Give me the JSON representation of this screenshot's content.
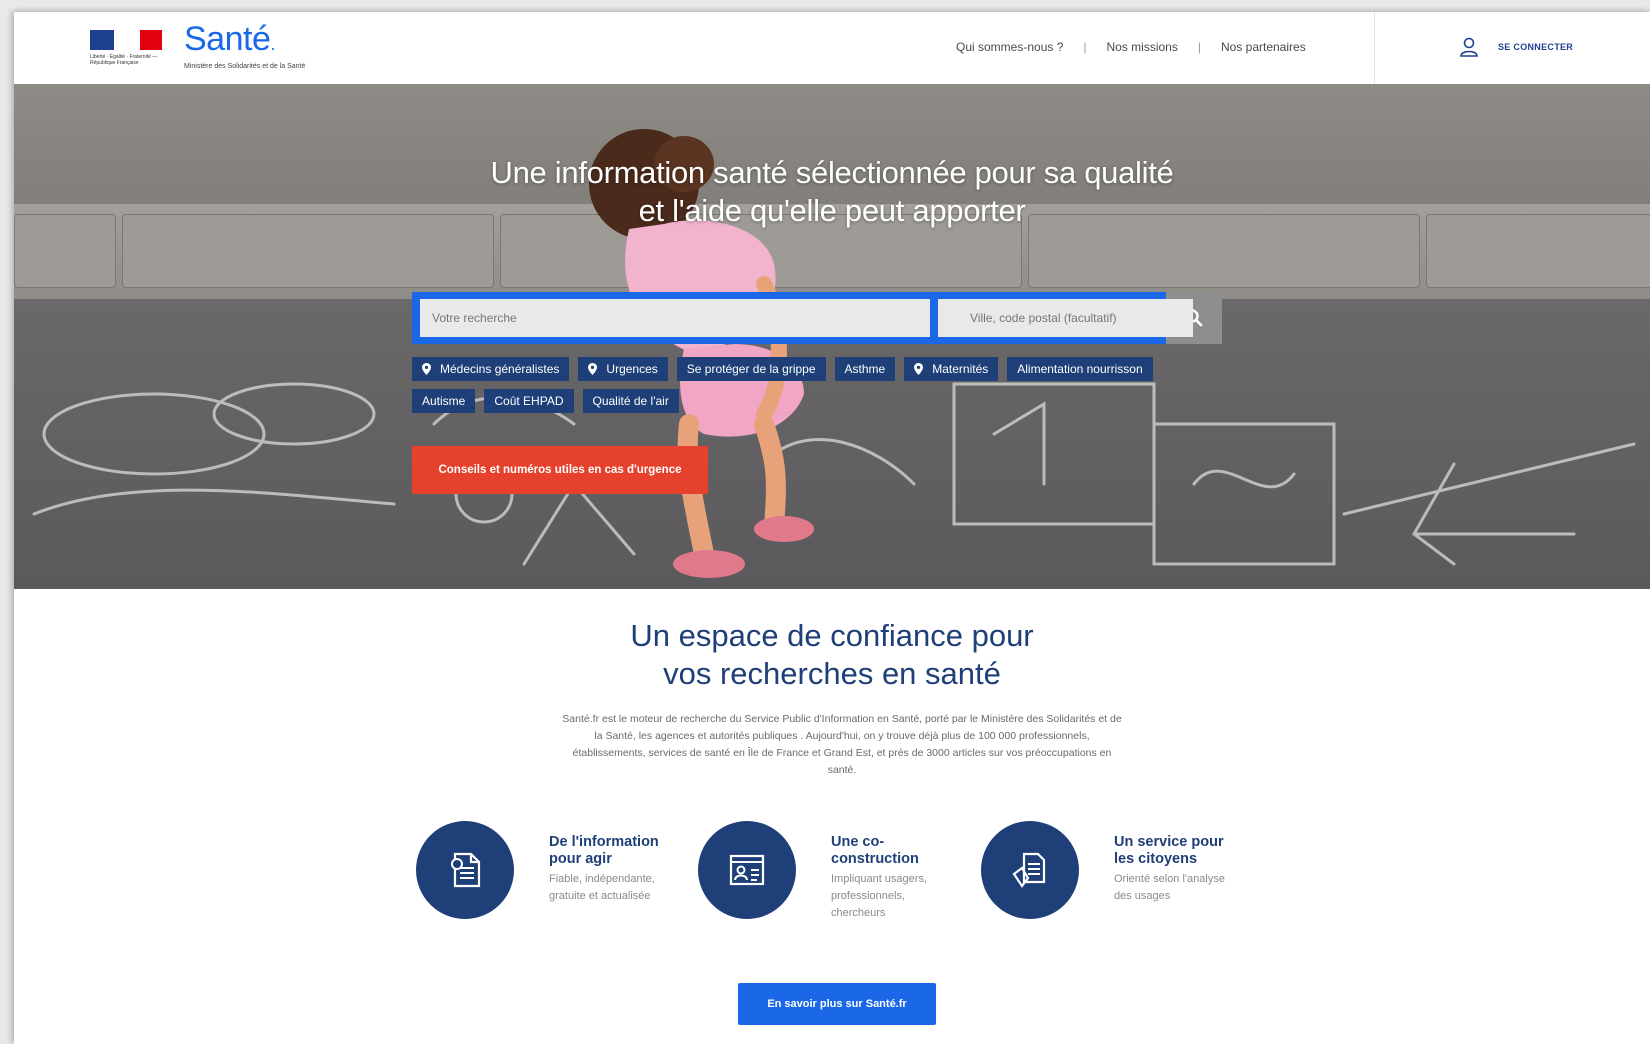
{
  "header": {
    "marianne_text": "Liberté · Égalité · Fraternité — République Française",
    "brand_name": "Santé",
    "brand_dot": ".",
    "brand_subtitle": "Ministère des Solidarités et de la Santé",
    "nav": [
      {
        "label": "Qui sommes-nous ?"
      },
      {
        "label": "Nos missions"
      },
      {
        "label": "Nos partenaires"
      }
    ],
    "login_label": "SE CONNECTER",
    "separator": "|"
  },
  "hero": {
    "title_line1": "Une information santé sélectionnée pour sa qualité",
    "title_line2": "et l'aide qu'elle peut apporter",
    "search": {
      "query_placeholder": "Votre recherche",
      "location_placeholder": "Ville, code postal (facultatif)"
    },
    "tags_row1": [
      {
        "label": "Médecins généralistes",
        "pin": true
      },
      {
        "label": "Urgences",
        "pin": true
      },
      {
        "label": "Se protéger de la grippe",
        "pin": false
      },
      {
        "label": "Asthme",
        "pin": false
      },
      {
        "label": "Maternités",
        "pin": true
      },
      {
        "label": "Alimentation nourrisson",
        "pin": false
      }
    ],
    "tags_row2": [
      {
        "label": "Autisme",
        "pin": false
      },
      {
        "label": "Coût EHPAD",
        "pin": false
      },
      {
        "label": "Qualité de l'air",
        "pin": false
      }
    ],
    "urgent_button": "Conseils et numéros utiles en cas d'urgence"
  },
  "main": {
    "title_line1": "Un espace de confiance pour",
    "title_line2": "vos recherches en santé",
    "description": "Santé.fr est le moteur de recherche du Service Public d'Information en Santé, porté par le Ministère des Solidarités et de la Santé, les agences et autorités publiques . Aujourd'hui, on y trouve déjà plus de 100 000 professionnels, établissements, services de santé en Île de France et Grand Est, et près de 3000 articles sur vos préoccupations en santé.",
    "features": [
      {
        "title": "De l'information pour agir",
        "desc": "Fiable, indépendante, gratuite et actualisée",
        "icon": "document-icon"
      },
      {
        "title": "Une co-construction",
        "desc": "Impliquant usagers, professionnels, chercheurs",
        "icon": "team-board-icon"
      },
      {
        "title": "Un service pour les citoyens",
        "desc": "Orienté selon l'analyse des usages",
        "icon": "documents-hand-icon"
      }
    ],
    "more_button": "En savoir plus sur Santé.fr"
  },
  "colors": {
    "brand_blue": "#1a68e8",
    "navy": "#1f3f78",
    "urgent_red": "#e5412d",
    "tag_bg": "#1e3f78"
  }
}
